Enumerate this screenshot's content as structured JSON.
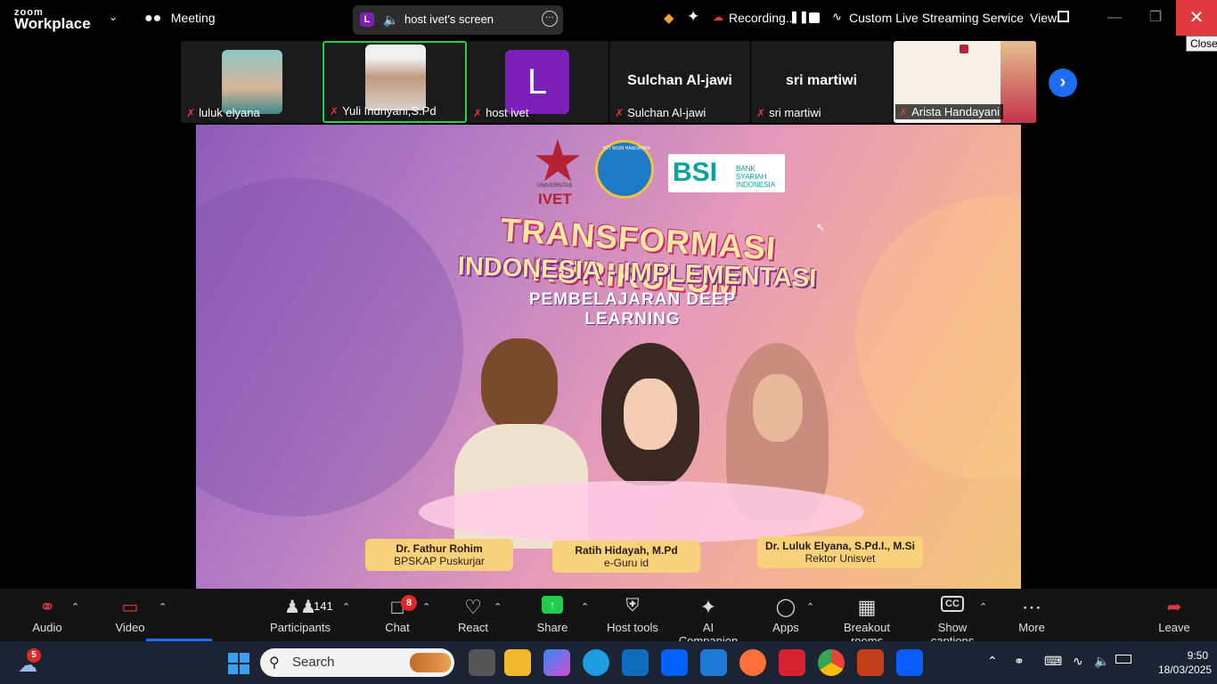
{
  "app": {
    "logo_top": "zoom",
    "logo_bottom": "Workplace"
  },
  "titlebar": {
    "meeting_label": "Meeting",
    "share_avatar_letter": "L",
    "share_label": "host ivet's screen",
    "recording_label": "Recording...",
    "live_streaming_label": "Custom Live Streaming Service",
    "view_label": "View",
    "close_tooltip": "Close"
  },
  "participants": [
    {
      "name": "luluk elyana",
      "type": "photo",
      "color": "#6fb1b3"
    },
    {
      "name": "Yuli Indriyani,S.Pd",
      "type": "photo",
      "color": "#c9b8a8",
      "active": true
    },
    {
      "name": "host ivet",
      "type": "avatar",
      "letter": "L",
      "color": "#7a20b8"
    },
    {
      "name": "Sulchan Al-jawi",
      "type": "name",
      "display": "Sulchan Al-jawi"
    },
    {
      "name": "sri martiwi",
      "type": "name",
      "display": "sri martiwi"
    },
    {
      "name": "Arista Handayani",
      "type": "photo",
      "color": "#f2ede4"
    }
  ],
  "shared_content": {
    "logos": [
      "UNIVERSITAS",
      "IVET",
      "TUT WURI HANDAYANI",
      "BSI",
      "BANK SYARIAH INDONESIA"
    ],
    "title_line1": "TRANSFORMASI KURIKULUM",
    "title_line2": "INDONESIA - IMPLEMENTASI",
    "title_line3": "PEMBELAJARAN DEEP LEARNING",
    "speakers": [
      {
        "name": "Dr. Fathur Rohim",
        "role": "BPSKAP Puskurjar"
      },
      {
        "name": "Ratih Hidayah, M.Pd",
        "role": "e-Guru id"
      },
      {
        "name": "Dr. Luluk Elyana, S.Pd.I., M.Si",
        "role": "Rektor Unisvet"
      }
    ]
  },
  "toolbar": {
    "audio": "Audio",
    "video": "Video",
    "participants": "Participants",
    "participants_count": "141",
    "chat": "Chat",
    "chat_badge": "8",
    "react": "React",
    "share": "Share",
    "host_tools": "Host tools",
    "ai_companion": "AI Companion",
    "apps": "Apps",
    "breakout_rooms": "Breakout rooms",
    "show_captions": "Show captions",
    "more": "More",
    "leave": "Leave"
  },
  "taskbar": {
    "weather_badge": "5",
    "search_placeholder": "Search",
    "time": "9:50",
    "date": "18/03/2025"
  },
  "colors": {
    "accent": "#1e6cf0",
    "active_border": "#1fd34f",
    "danger": "#e0393e",
    "share_green": "#1fcf4b"
  }
}
